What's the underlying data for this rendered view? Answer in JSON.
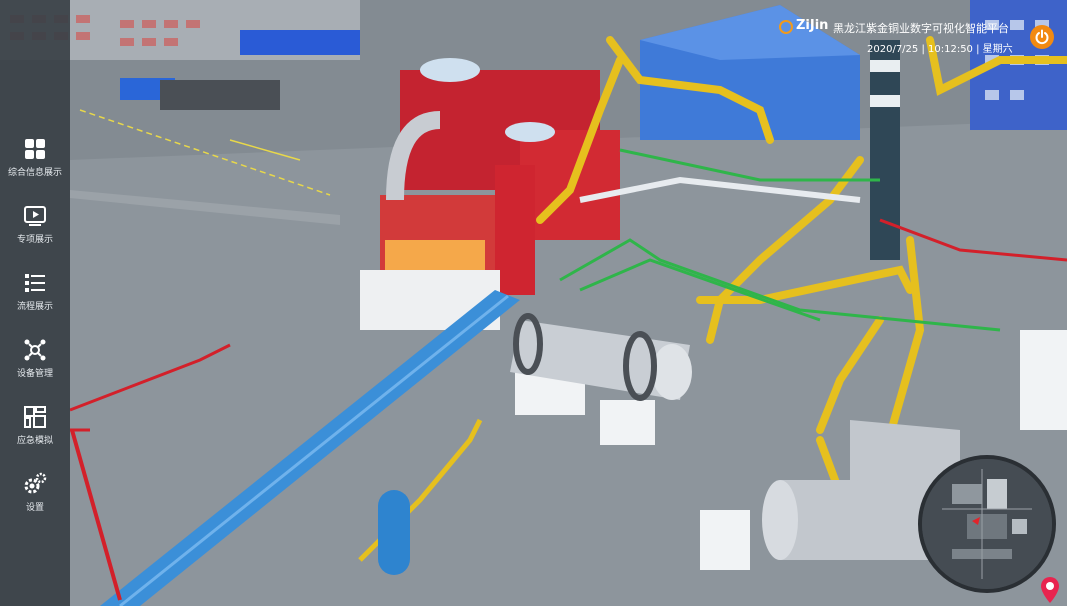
{
  "header": {
    "logo_text": "ZiJin",
    "app_title": "黑龙江紫金铜业数字可视化智能平台",
    "datetime": "2020/7/25 | 10:12:50 | 星期六",
    "power_icon": "power-icon",
    "accent_color": "#f28a12"
  },
  "sidebar": {
    "items": [
      {
        "label": "综合信息展示",
        "icon": "grid-icon"
      },
      {
        "label": "专项展示",
        "icon": "play-icon"
      },
      {
        "label": "流程展示",
        "icon": "list-icon"
      },
      {
        "label": "设备管理",
        "icon": "network-icon"
      },
      {
        "label": "应急模拟",
        "icon": "layout-icon"
      },
      {
        "label": "设置",
        "icon": "gear-icon"
      }
    ]
  },
  "minimap": {
    "label": "minimap"
  },
  "location_pin": {
    "icon": "location-pin-icon"
  }
}
